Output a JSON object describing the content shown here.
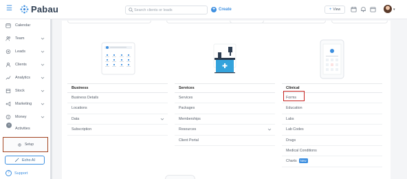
{
  "header": {
    "logo_text": "Pabau",
    "search": {
      "placeholder": "Search clients or leads"
    },
    "create_label": "Create",
    "view_label": "View"
  },
  "sidebar": {
    "items": [
      {
        "label": "Calendar",
        "icon": "calendar-icon",
        "chevron": false
      },
      {
        "label": "Team",
        "icon": "team-icon",
        "chevron": true
      },
      {
        "label": "Leads",
        "icon": "leads-icon",
        "chevron": true
      },
      {
        "label": "Clients",
        "icon": "clients-icon",
        "chevron": true
      },
      {
        "label": "Analytics",
        "icon": "analytics-icon",
        "chevron": true
      },
      {
        "label": "Stock",
        "icon": "stock-icon",
        "chevron": true
      },
      {
        "label": "Marketing",
        "icon": "marketing-icon",
        "chevron": true
      },
      {
        "label": "Money",
        "icon": "money-icon",
        "chevron": true
      },
      {
        "label": "Activities",
        "icon": "activities-icon",
        "chevron": false
      }
    ],
    "setup_label": "Setup",
    "echo_label": "Echo AI",
    "support_label": "Support"
  },
  "columns": {
    "business": {
      "title": "Business",
      "items": [
        "Business Details",
        "Locations",
        "Data",
        "Subscription"
      ]
    },
    "services": {
      "title": "Services",
      "items": [
        "Services",
        "Packages",
        "Memberships",
        "Resources",
        "Client Portal"
      ]
    },
    "clinical": {
      "title": "Clinical",
      "items": [
        "Forms",
        "Education",
        "Labs",
        "Lab Codes",
        "Drugs",
        "Medical Conditions",
        "Charts"
      ],
      "charts_badge": "New"
    }
  },
  "colors": {
    "accent": "#3d8fe0",
    "highlight_setup": "#a2431f",
    "highlight_forms": "#c6211e"
  }
}
